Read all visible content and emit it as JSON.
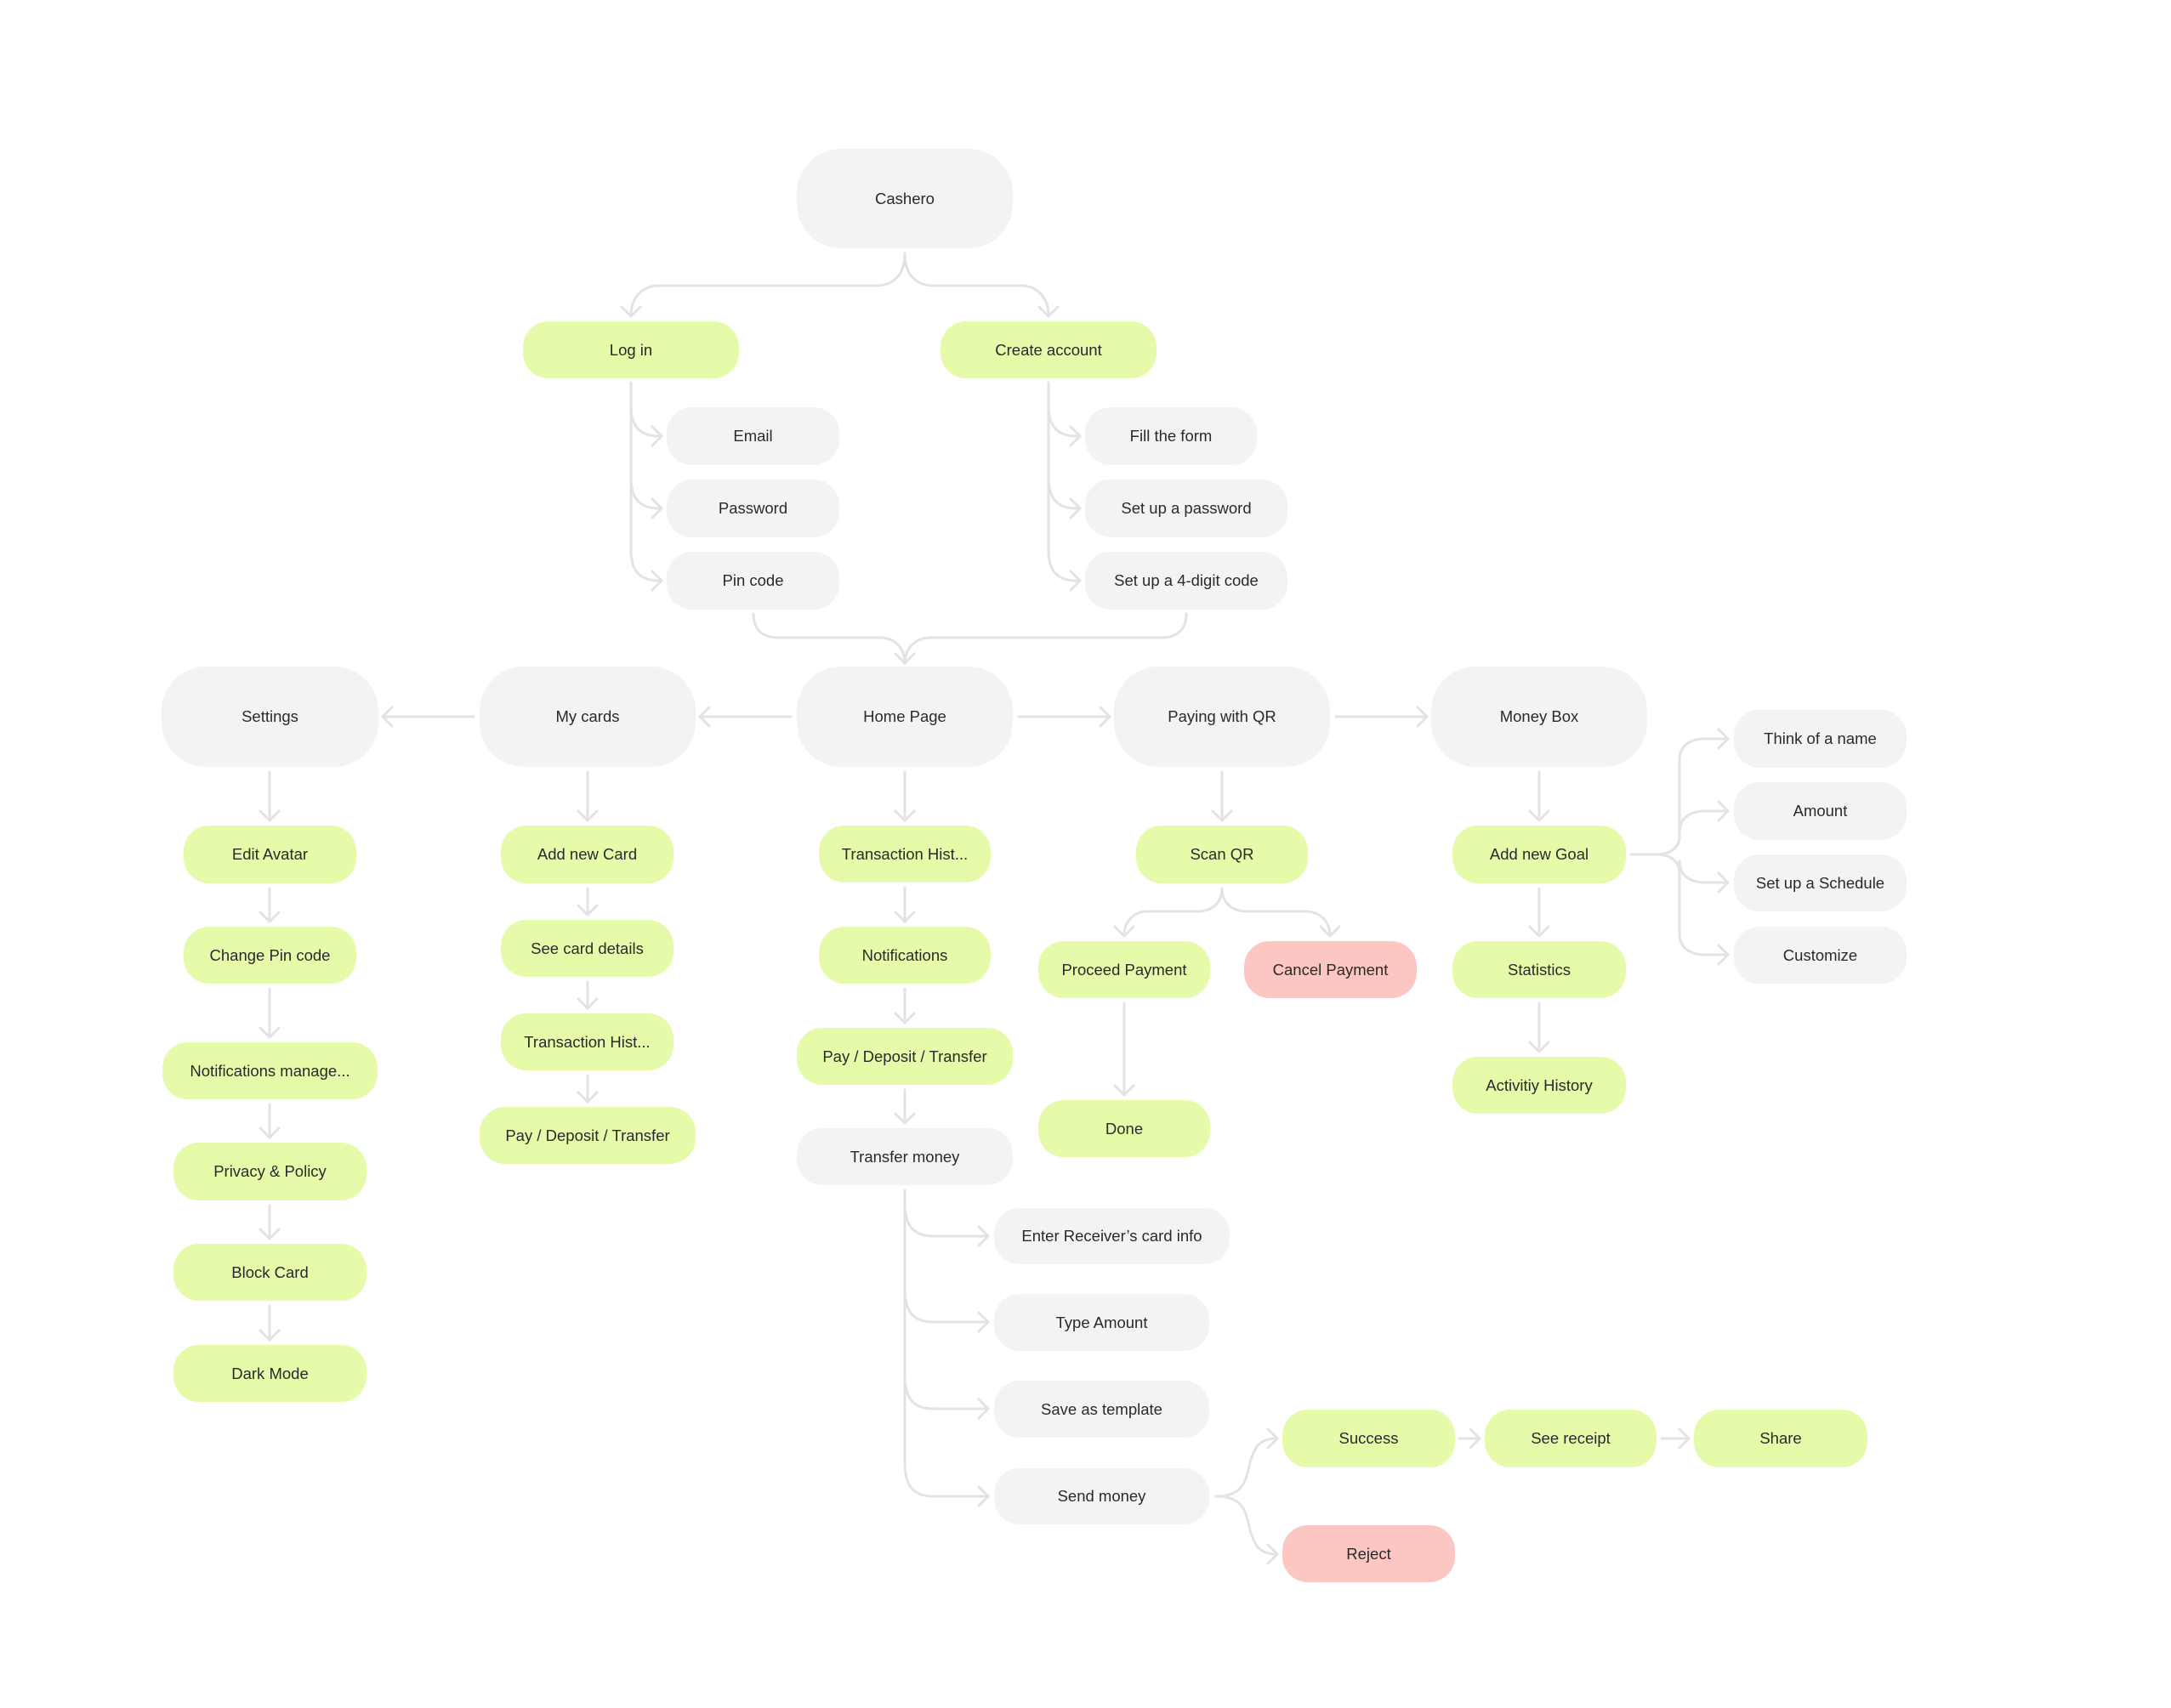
{
  "diagram": {
    "title": "Cashero",
    "colors": {
      "screen": "#f3f3f3",
      "action": "#e5fbaa",
      "negative": "#fcc6c2",
      "connector": "#e3e3e3",
      "text": "#2a2a2a"
    },
    "nodes": {
      "cashero": "Cashero",
      "login": "Log in",
      "create_account": "Create account",
      "email": "Email",
      "password": "Password",
      "pin_code": "Pin code",
      "fill_form": "Fill the form",
      "setup_password": "Set up a password",
      "setup_code": "Set up a 4-digit code",
      "settings": "Settings",
      "my_cards": "My cards",
      "home_page": "Home Page",
      "paying_qr": "Paying with QR",
      "money_box": "Money Box",
      "edit_avatar": "Edit Avatar",
      "change_pin": "Change Pin code",
      "notifications_manage": "Notifications manage...",
      "privacy_policy": "Privacy & Policy",
      "block_card": "Block Card",
      "dark_mode": "Dark Mode",
      "add_card": "Add new Card",
      "card_details": "See card details",
      "cards_transaction_history": "Transaction Hist...",
      "cards_pay_deposit": "Pay / Deposit / Transfer",
      "home_transaction_history": "Transaction Hist...",
      "home_notifications": "Notifications",
      "home_pay_deposit": "Pay / Deposit / Transfer",
      "transfer_money": "Transfer money",
      "enter_receiver": "Enter Receiver’s card info",
      "type_amount": "Type Amount",
      "save_template": "Save as template",
      "send_money": "Send money",
      "success": "Success",
      "see_receipt": "See receipt",
      "share": "Share",
      "reject": "Reject",
      "scan_qr": "Scan QR",
      "proceed_payment": "Proceed Payment",
      "cancel_payment": "Cancel Payment",
      "done": "Done",
      "add_goal": "Add new Goal",
      "statistics": "Statistics",
      "activity_history": "Activitiy History",
      "think_name": "Think of a name",
      "amount": "Amount",
      "setup_schedule": "Set up a Schedule",
      "customize": "Customize"
    },
    "edges": [
      [
        "cashero",
        "login"
      ],
      [
        "cashero",
        "create_account"
      ],
      [
        "login",
        "email"
      ],
      [
        "login",
        "password"
      ],
      [
        "login",
        "pin_code"
      ],
      [
        "create_account",
        "fill_form"
      ],
      [
        "create_account",
        "setup_password"
      ],
      [
        "create_account",
        "setup_code"
      ],
      [
        "pin_code",
        "home_page"
      ],
      [
        "setup_code",
        "home_page"
      ],
      [
        "home_page",
        "my_cards"
      ],
      [
        "my_cards",
        "settings"
      ],
      [
        "home_page",
        "paying_qr"
      ],
      [
        "paying_qr",
        "money_box"
      ],
      [
        "settings",
        "edit_avatar"
      ],
      [
        "edit_avatar",
        "change_pin"
      ],
      [
        "change_pin",
        "notifications_manage"
      ],
      [
        "notifications_manage",
        "privacy_policy"
      ],
      [
        "privacy_policy",
        "block_card"
      ],
      [
        "block_card",
        "dark_mode"
      ],
      [
        "my_cards",
        "add_card"
      ],
      [
        "add_card",
        "card_details"
      ],
      [
        "card_details",
        "cards_transaction_history"
      ],
      [
        "cards_transaction_history",
        "cards_pay_deposit"
      ],
      [
        "home_page",
        "home_transaction_history"
      ],
      [
        "home_transaction_history",
        "home_notifications"
      ],
      [
        "home_notifications",
        "home_pay_deposit"
      ],
      [
        "home_pay_deposit",
        "transfer_money"
      ],
      [
        "transfer_money",
        "enter_receiver"
      ],
      [
        "transfer_money",
        "type_amount"
      ],
      [
        "transfer_money",
        "save_template"
      ],
      [
        "transfer_money",
        "send_money"
      ],
      [
        "send_money",
        "success"
      ],
      [
        "send_money",
        "reject"
      ],
      [
        "success",
        "see_receipt"
      ],
      [
        "see_receipt",
        "share"
      ],
      [
        "paying_qr",
        "scan_qr"
      ],
      [
        "scan_qr",
        "proceed_payment"
      ],
      [
        "scan_qr",
        "cancel_payment"
      ],
      [
        "proceed_payment",
        "done"
      ],
      [
        "money_box",
        "add_goal"
      ],
      [
        "add_goal",
        "statistics"
      ],
      [
        "statistics",
        "activity_history"
      ],
      [
        "add_goal",
        "think_name"
      ],
      [
        "add_goal",
        "amount"
      ],
      [
        "add_goal",
        "setup_schedule"
      ],
      [
        "add_goal",
        "customize"
      ]
    ]
  }
}
